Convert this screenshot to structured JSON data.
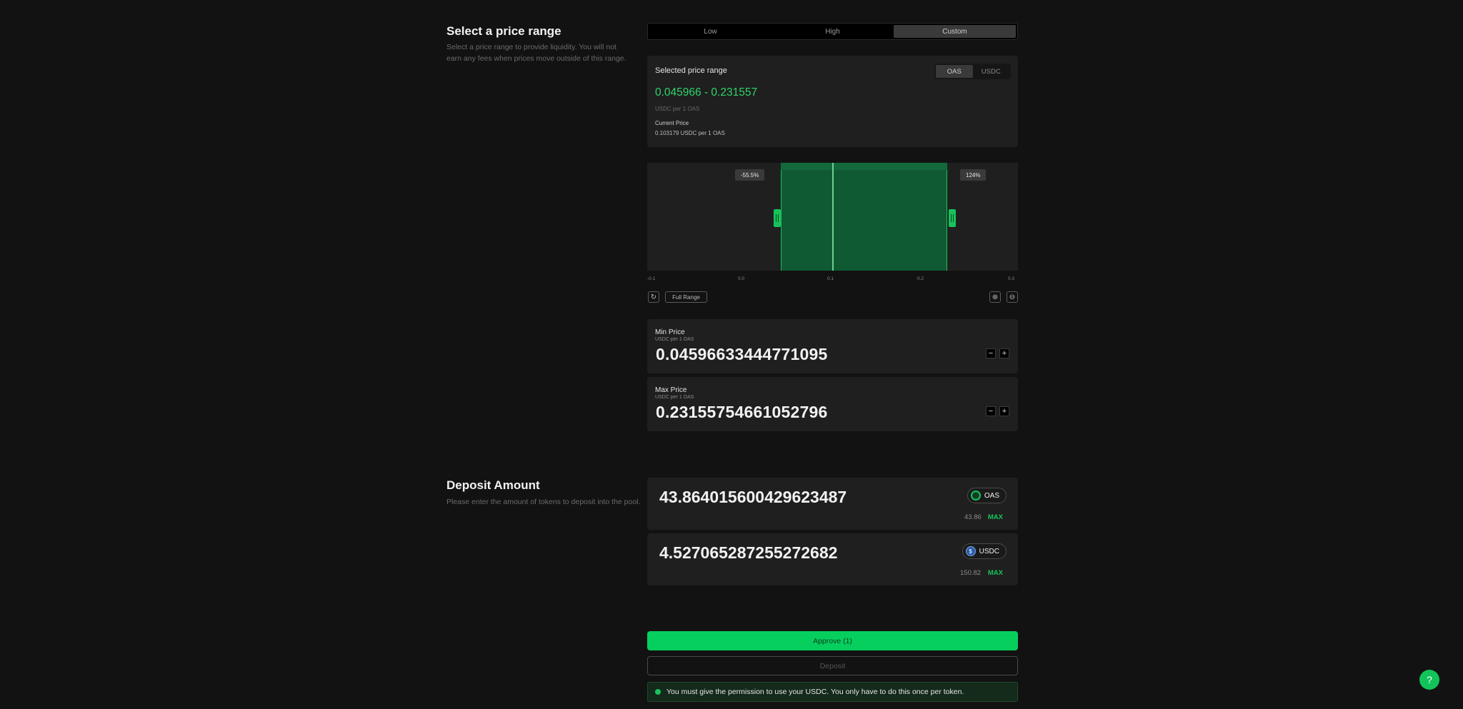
{
  "price_range": {
    "title": "Select a price range",
    "description": "Select a price range to provide liquidity. You will not earn any fees when prices move outside of this range.",
    "tabs": [
      "Low",
      "High",
      "Custom"
    ],
    "active_tab": "Custom"
  },
  "selected_range": {
    "title": "Selected price range",
    "token_toggle": [
      "OAS",
      "USDC"
    ],
    "active_token": "OAS",
    "value": "0.045966 - 0.231557",
    "unit": "USDC per 1 OAS",
    "current_price_label": "Current Price",
    "current_price_value": "0.103179 USDC per 1 OAS"
  },
  "chart": {
    "min_pct_label": "-55.5%",
    "max_pct_label": "124%",
    "ticks": [
      "-0.1",
      "0.0",
      "0.1",
      "0.2",
      "0.3"
    ],
    "full_range_label": "Full Range",
    "selected_min": 0.045966,
    "selected_max": 0.231557,
    "current_price": 0.103179,
    "x_range": [
      -0.1,
      0.3
    ]
  },
  "min_price": {
    "label": "Min Price",
    "unit": "USDC per 1 OAS",
    "value": "0.04596633444771095",
    "minus": "−",
    "plus": "+"
  },
  "max_price": {
    "label": "Max Price",
    "unit": "USDC per 1 OAS",
    "value": "0.23155754661052796",
    "minus": "−",
    "plus": "+"
  },
  "deposit": {
    "title": "Deposit Amount",
    "description": "Please enter the amount of tokens to deposit into the pool.",
    "tokens": [
      {
        "amount": "43.864015600429623487",
        "symbol": "OAS",
        "balance": "43.86",
        "max_label": "MAX"
      },
      {
        "amount": "4.527065287255272682",
        "symbol": "USDC",
        "balance": "150.82",
        "max_label": "MAX"
      }
    ]
  },
  "actions": {
    "approve_label": "Approve (1)",
    "deposit_label": "Deposit",
    "notice": "You must give the permission to use your USDC. You only have to do this once per token."
  },
  "help": {
    "label": "?"
  },
  "colors": {
    "accent": "#06cf5e",
    "range_text": "#2fd46a",
    "background": "#121212",
    "card": "#1f1f1f"
  }
}
